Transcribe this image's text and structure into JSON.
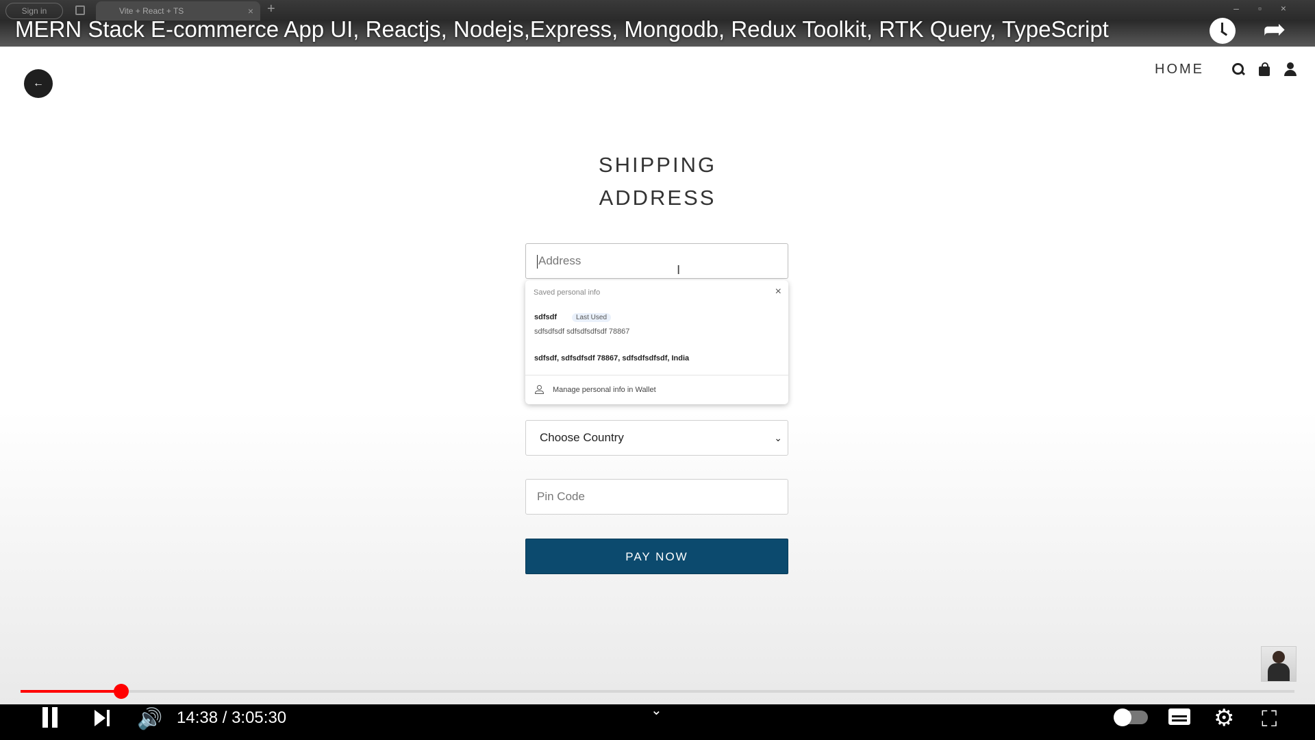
{
  "browser": {
    "signin_label": "Sign in",
    "tab_title": "Vite + React + TS",
    "tab_close": "×",
    "new_tab": "+",
    "window_buttons": "–▫×"
  },
  "video": {
    "title": "MERN Stack E-commerce App UI, Reactjs, Nodejs,Express, Mongodb, Redux Toolkit, RTK Query, TypeScript",
    "share_glyph": "➦",
    "current_time": "14:38",
    "duration": "3:05:30",
    "time_display": "14:38 / 3:05:30",
    "progress_fraction": 0.0788,
    "accent_color": "#ff0000"
  },
  "app": {
    "back_glyph": "←",
    "nav": {
      "home_label": "HOME"
    },
    "heading_line1": "SHIPPING",
    "heading_line2": "ADDRESS",
    "address_placeholder": "Address",
    "country_select": "Choose Country",
    "pin_placeholder": "Pin Code",
    "pay_button": "PAY NOW",
    "primary_color": "#0c4a6e"
  },
  "autofill": {
    "header": "Saved personal info",
    "close_glyph": "×",
    "entry_name": "sdfsdf",
    "entry_badge": "Last Used",
    "entry_detail": "sdfsdfsdf   sdfsdfsdfsdf   78867",
    "entry_full": "sdfsdf, sdfsdfsdf 78867, sdfsdfsdfsdf, India",
    "manage_label": "Manage personal info in Wallet"
  },
  "icons": {
    "volume": "🔊",
    "chevron": "⌄",
    "settings": "⚙",
    "exit_fullscreen": "⛶"
  }
}
